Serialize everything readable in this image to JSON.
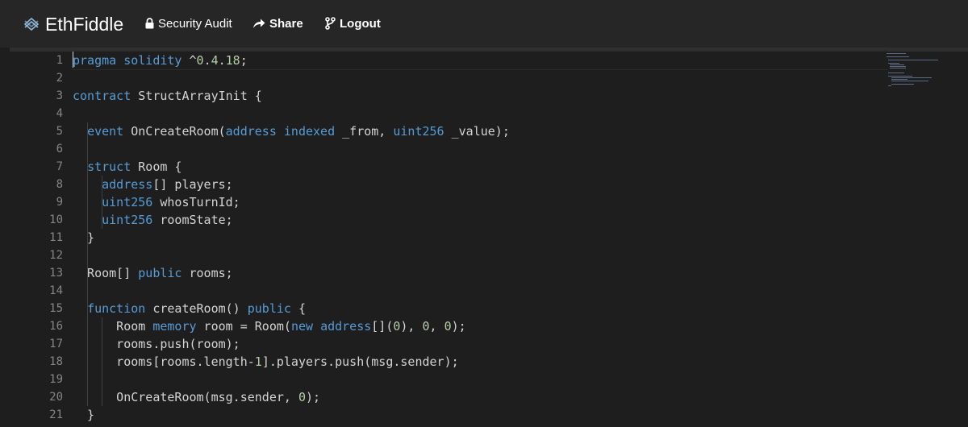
{
  "header": {
    "brand": "EthFiddle",
    "nav": {
      "security": "Security Audit",
      "share": "Share",
      "logout": "Logout"
    }
  },
  "editor": {
    "language": "solidity",
    "line_numbers": [
      "1",
      "2",
      "3",
      "4",
      "5",
      "6",
      "7",
      "8",
      "9",
      "10",
      "11",
      "12",
      "13",
      "14",
      "15",
      "16",
      "17",
      "18",
      "19",
      "20",
      "21"
    ],
    "lines": [
      "pragma solidity ^0.4.18;",
      "",
      "contract StructArrayInit {",
      "",
      "  event OnCreateRoom(address indexed _from, uint256 _value);",
      "",
      "  struct Room {",
      "    address[] players;",
      "    uint256 whosTurnId;",
      "    uint256 roomState;",
      "  }",
      "",
      "  Room[] public rooms;",
      "",
      "  function createRoom() public {",
      "      Room memory room = Room(new address[](0), 0, 0);",
      "      rooms.push(room);",
      "      rooms[rooms.length-1].players.push(msg.sender);",
      "",
      "      OnCreateRoom(msg.sender, 0);",
      "  }"
    ]
  },
  "colors": {
    "keyword": "#569cd6",
    "number": "#b5cea8",
    "text": "#d4d4d4",
    "line_number": "#858585",
    "background": "#1e1e1e",
    "header": "#262626"
  }
}
